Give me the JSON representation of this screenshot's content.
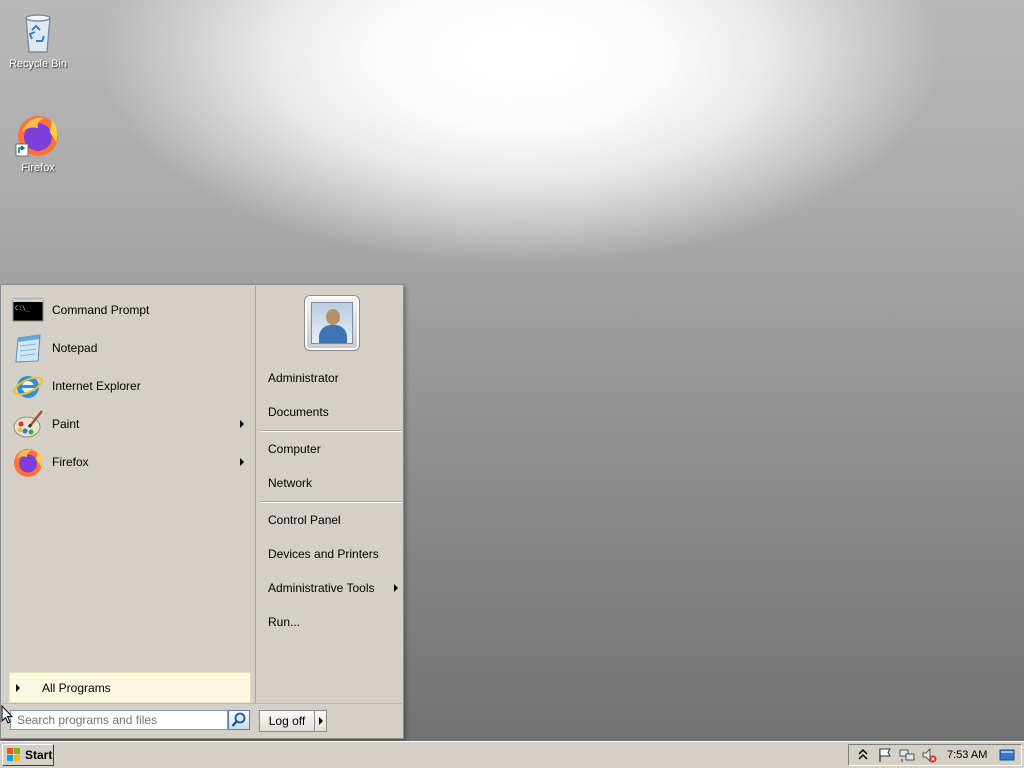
{
  "desktop": {
    "icons": [
      {
        "label": "Recycle Bin",
        "icon": "recycle-bin-icon"
      },
      {
        "label": "Firefox",
        "icon": "firefox-icon"
      }
    ]
  },
  "start_menu": {
    "pinned": [
      {
        "label": "Command Prompt",
        "icon": "command-prompt-icon",
        "submenu": false
      },
      {
        "label": "Notepad",
        "icon": "notepad-icon",
        "submenu": false
      },
      {
        "label": "Internet Explorer",
        "icon": "internet-explorer-icon",
        "submenu": false
      },
      {
        "label": "Paint",
        "icon": "paint-icon",
        "submenu": true
      },
      {
        "label": "Firefox",
        "icon": "firefox-icon",
        "submenu": true
      }
    ],
    "all_programs_label": "All Programs",
    "search_placeholder": "Search programs and files",
    "right_items": [
      {
        "label": "Administrator",
        "submenu": false
      },
      {
        "label": "Documents",
        "submenu": false
      },
      {
        "label": "Computer",
        "submenu": false
      },
      {
        "label": "Network",
        "submenu": false
      },
      {
        "label": "Control Panel",
        "submenu": false
      },
      {
        "label": "Devices and Printers",
        "submenu": false
      },
      {
        "label": "Administrative Tools",
        "submenu": true
      },
      {
        "label": "Run...",
        "submenu": false
      }
    ],
    "logoff_label": "Log off"
  },
  "taskbar": {
    "start_label": "Start",
    "clock": "7:53 AM",
    "tray_icons": [
      "show-hidden-icons-chevron-icon",
      "action-center-flag-icon",
      "network-icon",
      "volume-muted-icon",
      "show-desktop-icon"
    ]
  },
  "colors": {
    "menu_bg": "#d4d0c8",
    "all_programs_bg": "#fbf9e0",
    "search_border": "#7f9db9"
  }
}
